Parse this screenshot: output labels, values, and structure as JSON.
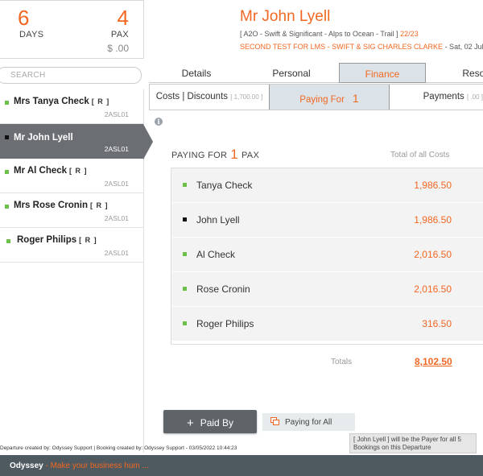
{
  "summary": {
    "days": "6",
    "days_label": "DAYS",
    "pax": "4",
    "pax_label": "PAX",
    "amount": "$ .00"
  },
  "header": {
    "client_name": "Mr John Lyell",
    "trip_prefix": "[ A2O - Swift & Significant - Alps to Ocean - Trail ]",
    "trip_code": "22/23",
    "test_line": "SECOND TEST FOR LMS - SWIFT & SIG CHARLES CLARKE",
    "date_text": " - Sat, 02 Jul"
  },
  "search": {
    "placeholder": "SEARCH"
  },
  "passengers": [
    {
      "name": "Mrs Tanya Check",
      "role": "[ R ]",
      "code": "2ASL01"
    },
    {
      "name": "Mr John Lyell",
      "role": "",
      "code": "2ASL01"
    },
    {
      "name": "Mr Al Check",
      "role": "[ R ]",
      "code": "2ASL01"
    },
    {
      "name": "Mrs Rose Cronin",
      "role": "[ R ]",
      "code": "2ASL01"
    },
    {
      "name": "Roger Philips",
      "role": "[ R ]",
      "code": "2ASL01"
    }
  ],
  "main_tabs": [
    "Details",
    "Personal",
    "Finance",
    "Resou"
  ],
  "sub_tabs": {
    "costs": "Costs | Discounts",
    "costs_amount": "[ 1,700.00 ]",
    "paying_for": "Paying For",
    "paying_for_count": "1",
    "payments": "Payments",
    "payments_amount": "[ .00 ]"
  },
  "paying": {
    "label_pre": "PAYING FOR",
    "count": "1",
    "label_post": "PAX",
    "total_header": "Total of all Costs"
  },
  "costs": [
    {
      "name": "Tanya Check",
      "amount": "1,986.50"
    },
    {
      "name": "John Lyell",
      "amount": "1,986.50"
    },
    {
      "name": "Al Check",
      "amount": "2,016.50"
    },
    {
      "name": "Rose Cronin",
      "amount": "2,016.50"
    },
    {
      "name": "Roger Philips",
      "amount": "316.50"
    }
  ],
  "totals": {
    "label": "Totals",
    "value": "8,102.50"
  },
  "buttons": {
    "paid_by": "Paid By",
    "paying_for_all": "Paying for All"
  },
  "tooltip": "[ John Lyell ] will be the Payer for all 5 Bookings on this Departure",
  "footer_meta": "Departure created by: Odyssey Support | Booking created by: Odyssey Support - 03/05/2022 10:44:23",
  "bottom_bar": {
    "brand": "Odyssey",
    "tagline": " - Make your business hum ..."
  },
  "colors": {
    "accent": "#f26722",
    "green_dot": "#6cc04a",
    "active_bg": "#6b6f73",
    "bar": "#4f5a60"
  }
}
